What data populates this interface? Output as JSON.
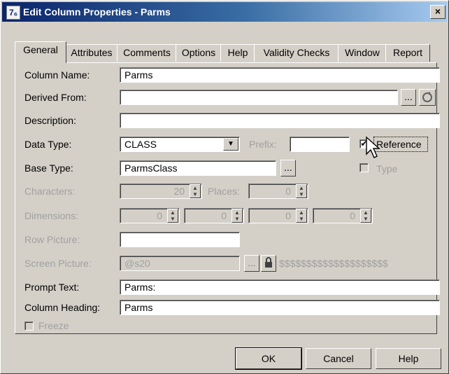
{
  "window": {
    "title": "Edit Column Properties - Parms",
    "icon_text": "7₆",
    "close_label": "×"
  },
  "tabs": [
    {
      "label": "General"
    },
    {
      "label": "Attributes"
    },
    {
      "label": "Comments"
    },
    {
      "label": "Options"
    },
    {
      "label": "Help"
    },
    {
      "label": "Validity Checks"
    },
    {
      "label": "Window"
    },
    {
      "label": "Report"
    }
  ],
  "fields": {
    "column_name": {
      "label": "Column Name:",
      "value": "Parms"
    },
    "derived_from": {
      "label": "Derived From:",
      "value": "",
      "browse_label": "..."
    },
    "description": {
      "label": "Description:",
      "value": ""
    },
    "data_type": {
      "label": "Data Type:",
      "value": "CLASS",
      "dropdown_glyph": "▼"
    },
    "prefix": {
      "label": "Prefix:",
      "value": ""
    },
    "reference": {
      "label": "Reference",
      "checked": "✔"
    },
    "base_type": {
      "label": "Base Type:",
      "value": "ParmsClass",
      "browse_label": "..."
    },
    "type_check": {
      "label": "Type"
    },
    "characters": {
      "label": "Characters:",
      "value": "20"
    },
    "places": {
      "label": "Places:",
      "value": "0"
    },
    "dimensions": {
      "label": "Dimensions:",
      "values": [
        "0",
        "0",
        "0",
        "0"
      ]
    },
    "row_picture": {
      "label": "Row Picture:",
      "value": ""
    },
    "screen_picture": {
      "label": "Screen Picture:",
      "value": "@s20",
      "browse_label": "...",
      "preview": "$$$$$$$$$$$$$$$$$$$$"
    },
    "prompt_text": {
      "label": "Prompt Text:",
      "value": "Parms:"
    },
    "column_heading": {
      "label": "Column Heading:",
      "value": "Parms"
    },
    "freeze": {
      "label": "Freeze"
    }
  },
  "buttons": {
    "ok": "OK",
    "cancel": "Cancel",
    "help": "Help"
  },
  "colors": {
    "titlebar_start": "#0a246a",
    "titlebar_end": "#a6caf0",
    "face": "#d4d0c8"
  }
}
